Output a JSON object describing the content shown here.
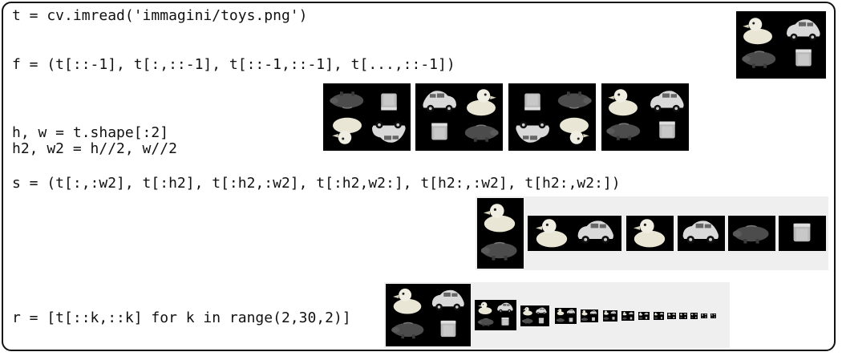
{
  "code": {
    "line1": "t = cv.imread('immagini/toys.png')",
    "line2": "f = (t[::-1], t[:,::-1], t[::-1,::-1], t[...,::-1])",
    "line3a": "h, w = t.shape[:2]",
    "line3b": "h2, w2 = h//2, w//2",
    "line4": "s = (t[:,:w2], t[:h2], t[:h2,:w2], t[:h2,w2:], t[h2:,:w2], t[h2:,w2:])",
    "line5": "r = [t[::k,::k] for k in range(2,30,2)]"
  },
  "icons": {
    "duck": "duck-icon",
    "car": "car-icon",
    "piggy": "piggy-bank-icon",
    "cup": "cup-icon"
  },
  "colors": {
    "panel_bg": "#000000",
    "strip_bg": "#efefef",
    "frame": "#111111"
  }
}
